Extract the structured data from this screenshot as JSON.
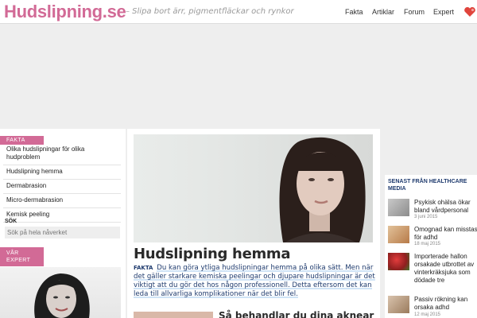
{
  "header": {
    "logo": "Hudslipning.se",
    "tagline": "– Slipa bort ärr, pigmentfläckar och rynkor",
    "nav": [
      "Fakta",
      "Artiklar",
      "Forum",
      "Expert"
    ],
    "heart_icon": "heart-icon"
  },
  "sidebar": {
    "fakta_label": "FAKTA",
    "menu": [
      "Olika hudslipningar för olika hudproblem",
      "Hudslipning hemma",
      "Dermabrasion",
      "Micro-dermabrasion",
      "Kemisk peeling"
    ],
    "search_label": "SÖK",
    "search_placeholder": "Sök på hela nåverket",
    "expert_label": "VÅR EXPERT"
  },
  "main": {
    "title": "Hudslipning hemma",
    "intro_tag": "FAKTA",
    "intro": "Du kan göra ytliga hudslipningar hemma på olika sätt. Men när det gäller starkare kemiska peelingar och djupare hudslipningar är det viktigt att du gör det hos någon professionell. Detta eftersom det kan leda till allvarliga komplikationer när det blir fel.",
    "next_title": "Så behandlar du dina aknear"
  },
  "right": {
    "heading": "SENAST FRÅN HEALTHCARE MEDIA",
    "items": [
      {
        "title": "Psykisk ohälsa ökar bland vårdpersonal",
        "date": "3 juni 2015"
      },
      {
        "title": "Omognad kan misstas för adhd",
        "date": "18 maj 2015"
      },
      {
        "title": "Importerade hallon orsakade utbrottet av vinterkräksjuka som dödade tre",
        "date": "12 maj 2015"
      },
      {
        "title": "Passiv rökning kan orsaka adhd",
        "date": "12 maj 2015"
      }
    ]
  },
  "colors": {
    "brand_pink": "#d26a96",
    "link_navy": "#1f3b6e"
  }
}
